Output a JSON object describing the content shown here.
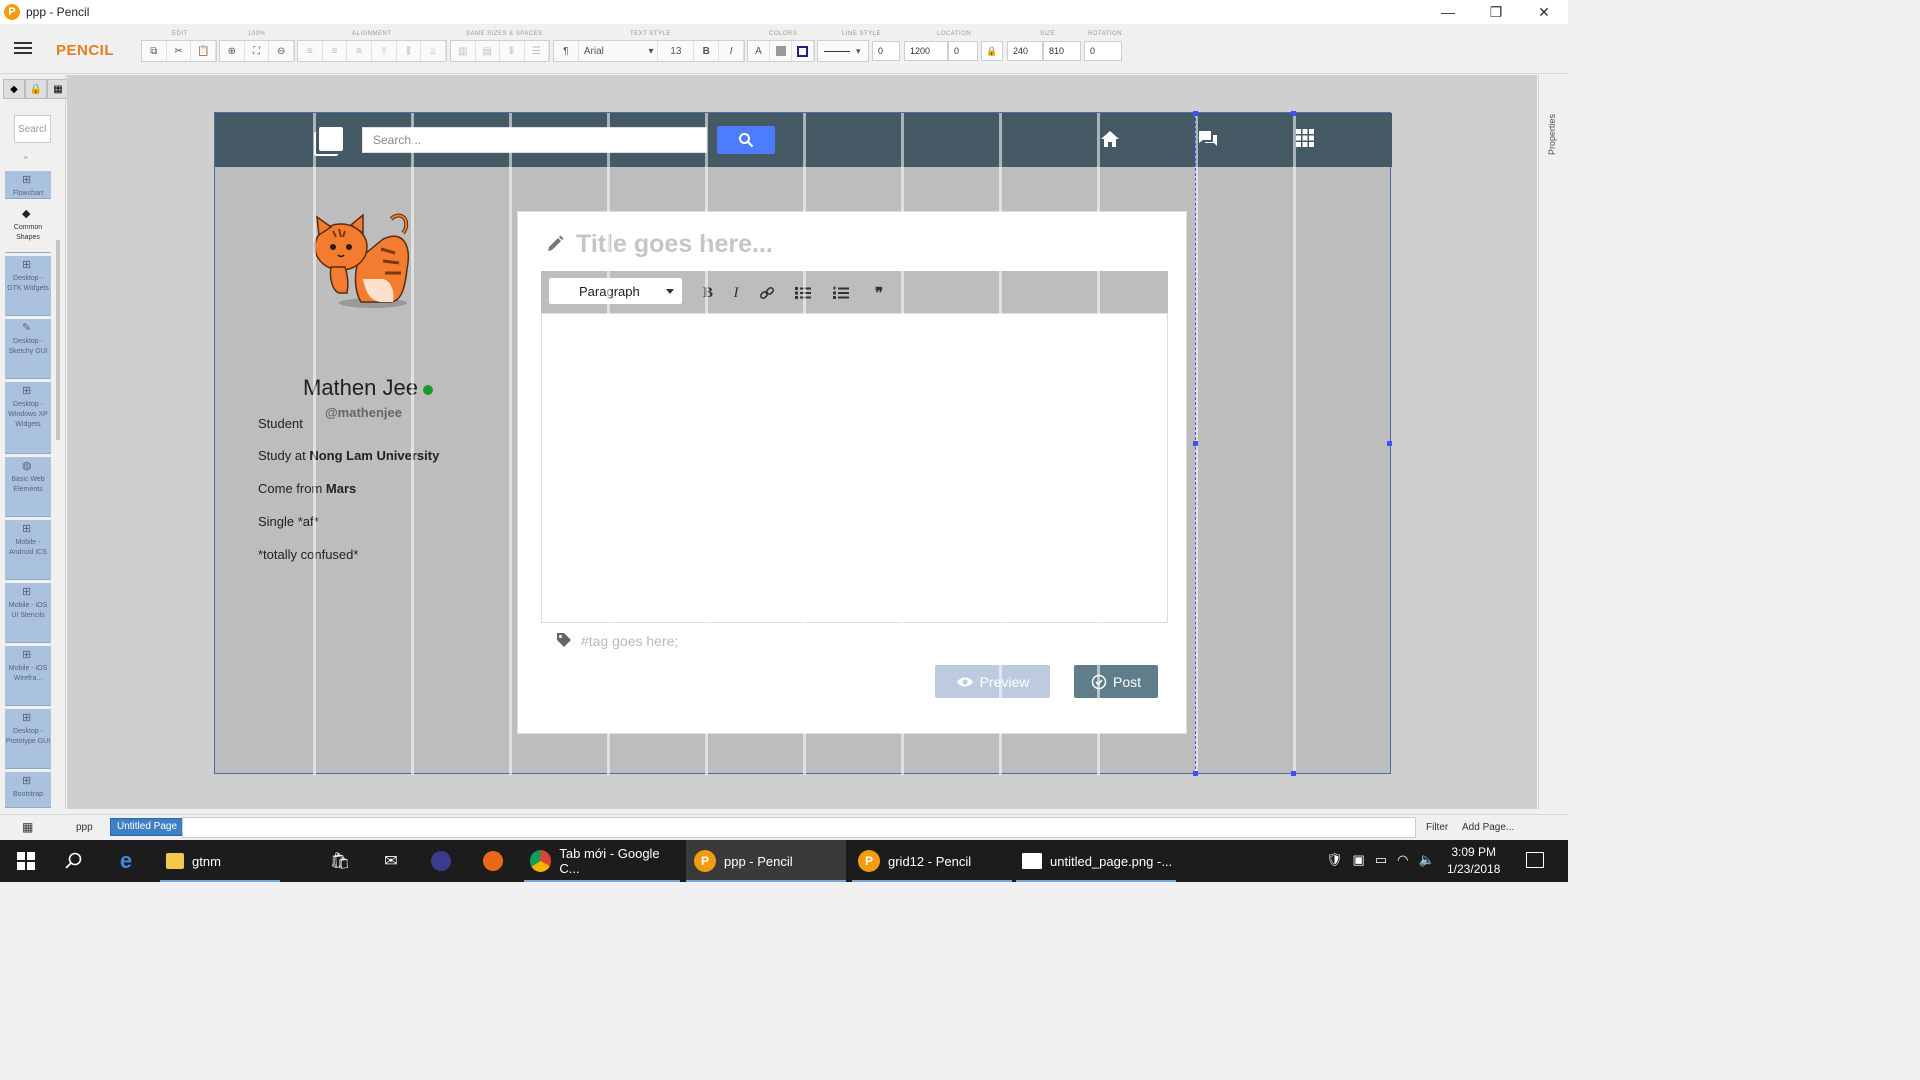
{
  "window": {
    "title": "ppp - Pencil",
    "logo_letter": "P",
    "minimize": "—",
    "maximize": "❐",
    "close": "✕"
  },
  "toolbar": {
    "brand": "PENCIL",
    "group_labels": {
      "edit": "EDIT",
      "zoom": "100%",
      "alignment": "ALIGNMENT",
      "same_sizes": "SAME SIZES & SPACES",
      "text_style": "TEXT STYLE",
      "colors": "COLORS",
      "line_style": "LINE STYLE",
      "location": "LOCATION",
      "size": "SIZE",
      "rotation": "ROTATION"
    },
    "font": "Arial",
    "font_size": "13",
    "bold": "B",
    "italic": "I",
    "text_color": "A",
    "line_width": "0",
    "location_x": "1200",
    "location_y": "0",
    "size_w": "240",
    "size_h": "810",
    "rotation": "0"
  },
  "left_panel": {
    "search_placeholder": "Searcl",
    "collections": [
      {
        "label": "Flowchart",
        "icon": "⊞"
      },
      {
        "label": "Common Shapes",
        "icon": "◆"
      },
      {
        "label": "Desktop - GTK Widgets",
        "icon": "⊞"
      },
      {
        "label": "Desktop - Sketchy GUI",
        "icon": "✎"
      },
      {
        "label": "Desktop - Windows XP Widgets",
        "icon": "⊞"
      },
      {
        "label": "Basic Web Elements",
        "icon": "◍"
      },
      {
        "label": "Mobile - Android ICS",
        "icon": "⊞"
      },
      {
        "label": "Mobile - iOS UI Stencils",
        "icon": "⊞"
      },
      {
        "label": "Mobile - iOS Wirefra...",
        "icon": "⊞"
      },
      {
        "label": "Desktop - Prototype GUI",
        "icon": "⊞"
      },
      {
        "label": "Bootstrap",
        "icon": "⊞"
      }
    ]
  },
  "right_panel": {
    "label": "Properties"
  },
  "mockup": {
    "nav": {
      "search_placeholder": "Search..."
    },
    "profile": {
      "name": "Mathen Jee",
      "handle": "@mathenjee",
      "role": "Student",
      "study_prefix": "Study at ",
      "study_place": "Nong Lam University",
      "from_prefix": "Come from ",
      "from_place": "Mars",
      "status": "Single *af*",
      "mood": "*totally confused*"
    },
    "editor": {
      "title_placeholder": "Title goes here...",
      "format_select": "Paragraph",
      "bold": "B",
      "italic": "I",
      "quote": "❞",
      "tag_placeholder": "#tag goes here;",
      "preview_label": "Preview",
      "post_label": "Post"
    }
  },
  "pagebar": {
    "document": "ppp",
    "page_tab": "Untitled Page",
    "filter": "Filter",
    "add_page": "Add Page..."
  },
  "taskbar": {
    "items": [
      {
        "label": "gtnm"
      },
      {
        "label": "Tab mới - Google C..."
      },
      {
        "label": "ppp - Pencil"
      },
      {
        "label": "grid12 - Pencil"
      },
      {
        "label": "untitled_page.png -..."
      }
    ],
    "time": "3:09 PM",
    "date": "1/23/2018"
  },
  "colors": {
    "nav": "#455a64",
    "search_button": "#4d7cfe",
    "brand": "#e67e22",
    "online": "#1a9c2b",
    "post": "#607d8b",
    "preview": "#bdcbe0"
  }
}
